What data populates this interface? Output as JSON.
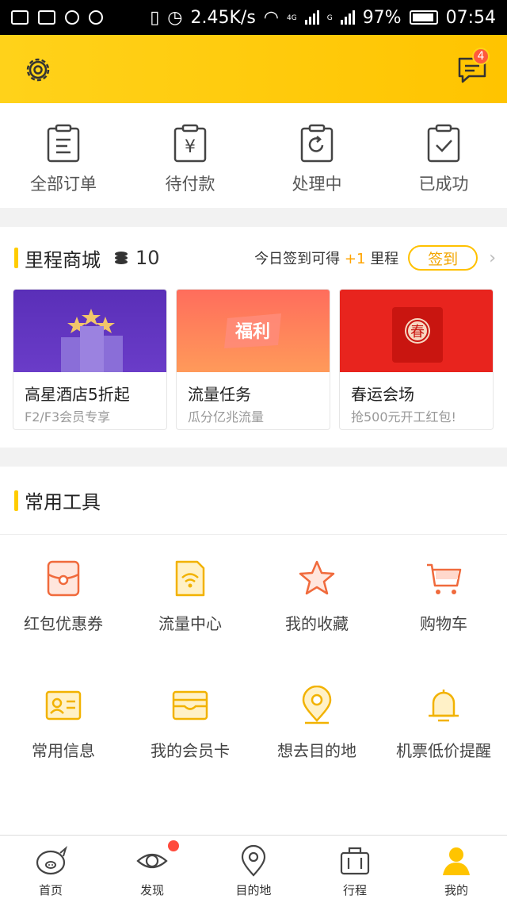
{
  "status_bar": {
    "network_speed": "2.45K/s",
    "network_labels": [
      "4G",
      "G"
    ],
    "battery": "97%",
    "time": "07:54"
  },
  "header": {
    "message_badge": "4"
  },
  "orders": [
    {
      "label": "全部订单",
      "icon": "clipboard-list-icon"
    },
    {
      "label": "待付款",
      "icon": "clipboard-yen-icon"
    },
    {
      "label": "处理中",
      "icon": "clipboard-refresh-icon"
    },
    {
      "label": "已成功",
      "icon": "clipboard-check-icon"
    }
  ],
  "mileage": {
    "title": "里程商城",
    "coins": "10",
    "tip_prefix": "今日签到可得",
    "tip_bonus": "+1",
    "tip_suffix": "里程",
    "sign_label": "签到",
    "cards": [
      {
        "title": "高星酒店5折起",
        "subtitle": "F2/F3会员专享"
      },
      {
        "title": "流量任务",
        "subtitle": "瓜分亿兆流量",
        "banner_text": "福利"
      },
      {
        "title": "春运会场",
        "subtitle": "抢500元开工红包!",
        "banner_text": "春"
      }
    ]
  },
  "tools": {
    "title": "常用工具",
    "items": [
      {
        "label": "红包优惠券",
        "icon": "red-packet-icon"
      },
      {
        "label": "流量中心",
        "icon": "wifi-sim-icon"
      },
      {
        "label": "我的收藏",
        "icon": "star-icon"
      },
      {
        "label": "购物车",
        "icon": "cart-icon"
      },
      {
        "label": "常用信息",
        "icon": "id-card-icon"
      },
      {
        "label": "我的会员卡",
        "icon": "wallet-card-icon"
      },
      {
        "label": "想去目的地",
        "icon": "location-pin-icon"
      },
      {
        "label": "机票低价提醒",
        "icon": "bell-icon"
      }
    ]
  },
  "tabbar": [
    {
      "label": "首页",
      "icon": "pig-icon"
    },
    {
      "label": "发现",
      "icon": "eye-icon"
    },
    {
      "label": "目的地",
      "icon": "pin-icon"
    },
    {
      "label": "行程",
      "icon": "luggage-icon"
    },
    {
      "label": "我的",
      "icon": "user-icon"
    }
  ],
  "colors": {
    "brand_yellow": "#ffcc00",
    "accent_orange": "#f2a500",
    "badge_red": "#ff5a3c"
  }
}
